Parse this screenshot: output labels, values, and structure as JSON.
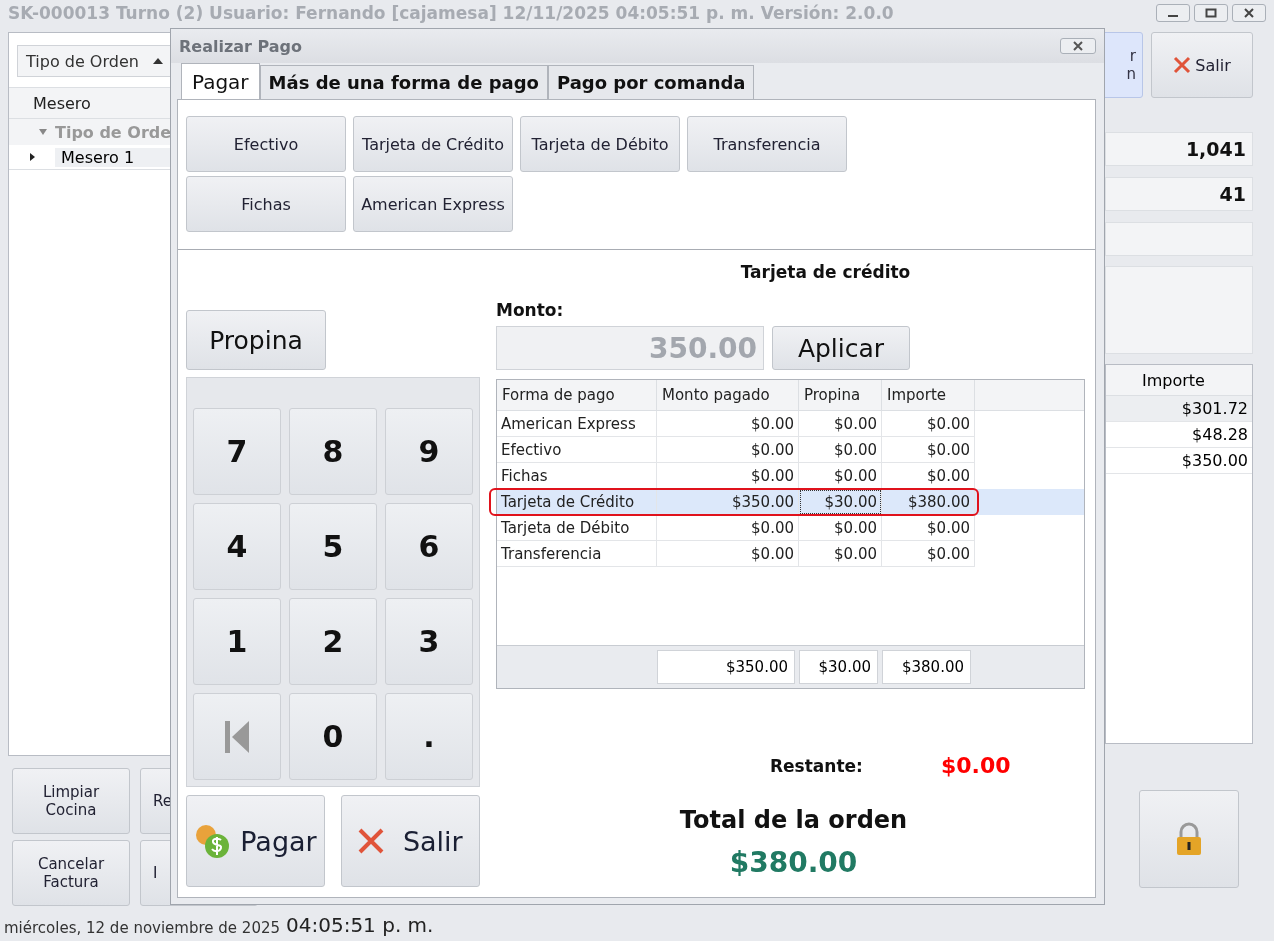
{
  "title_bar": {
    "title": "SK-000013 Turno (2) Usuario: Fernando [cajamesa] 12/11/2025 04:05:51 p. m. Versión: 2.0.0"
  },
  "background": {
    "order_type": "Tipo de Orden",
    "grid_column": "Mesero",
    "group_row": "Tipo de Orde",
    "grid_rows": [
      {
        "label": "Mesero 1",
        "selected": true
      }
    ],
    "bottom_buttons": [
      {
        "label": "Limpiar\nCocina"
      },
      {
        "label": "Re"
      },
      {
        "label": "Cancelar\nFactura"
      },
      {
        "label": "I"
      }
    ],
    "partial_button": "r\nn",
    "exit": "Salir",
    "counters": [
      "1,041",
      "41"
    ],
    "table_column": "Importe",
    "table_rows": [
      {
        "value": "$301.72",
        "selected": true
      },
      {
        "value": "$48.28",
        "selected": false
      },
      {
        "value": "$350.00",
        "selected": false
      }
    ]
  },
  "dialog": {
    "title": "Realizar Pago",
    "tabs": [
      {
        "label": "Pagar",
        "selected": true
      },
      {
        "label": "Más de una forma de pago",
        "selected": false
      },
      {
        "label": "Pago por comanda",
        "selected": false
      }
    ],
    "methods": [
      [
        "Efectivo",
        "Tarjeta de Crédito",
        "Tarjeta de Débito",
        "Transferencia"
      ],
      [
        "Fichas",
        "American Express"
      ]
    ],
    "method_title": "Tarjeta de crédito",
    "amount_label": "Monto:",
    "amount_value": "350.00",
    "apply": "Aplicar",
    "tip": "Propina",
    "keypad": [
      {
        "kind": "digit",
        "label": "7"
      },
      {
        "kind": "digit",
        "label": "8"
      },
      {
        "kind": "digit",
        "label": "9"
      },
      {
        "kind": "digit",
        "label": "4"
      },
      {
        "kind": "digit",
        "label": "5"
      },
      {
        "kind": "digit",
        "label": "6"
      },
      {
        "kind": "digit",
        "label": "1"
      },
      {
        "kind": "digit",
        "label": "2"
      },
      {
        "kind": "digit",
        "label": "3"
      },
      {
        "kind": "back"
      },
      {
        "kind": "digit",
        "label": "0"
      },
      {
        "kind": "digit",
        "label": "."
      }
    ],
    "pay": "Pagar",
    "exit": "Salir",
    "table": {
      "columns": [
        "Forma de pago",
        "Monto pagado",
        "Propina",
        "Importe"
      ],
      "rows": [
        {
          "cells": [
            "American Express",
            "$0.00",
            "$0.00",
            "$0.00"
          ],
          "selected": false
        },
        {
          "cells": [
            "Efectivo",
            "$0.00",
            "$0.00",
            "$0.00"
          ],
          "selected": false
        },
        {
          "cells": [
            "Fichas",
            "$0.00",
            "$0.00",
            "$0.00"
          ],
          "selected": false
        },
        {
          "cells": [
            "Tarjeta de Crédito",
            "$350.00",
            "$30.00",
            "$380.00"
          ],
          "selected": true
        },
        {
          "cells": [
            "Tarjeta de Débito",
            "$0.00",
            "$0.00",
            "$0.00"
          ],
          "selected": false
        },
        {
          "cells": [
            "Transferencia",
            "$0.00",
            "$0.00",
            "$0.00"
          ],
          "selected": false
        }
      ],
      "totals": [
        "$350.00",
        "$30.00",
        "$380.00"
      ]
    },
    "remaining_label": "Restante:",
    "remaining_value": "$0.00",
    "total_label": "Total de la orden",
    "total_value": "$380.00"
  },
  "status_bar": {
    "date": "miércoles, 12 de noviembre de 2025",
    "time": "04:05:51 p. m."
  }
}
